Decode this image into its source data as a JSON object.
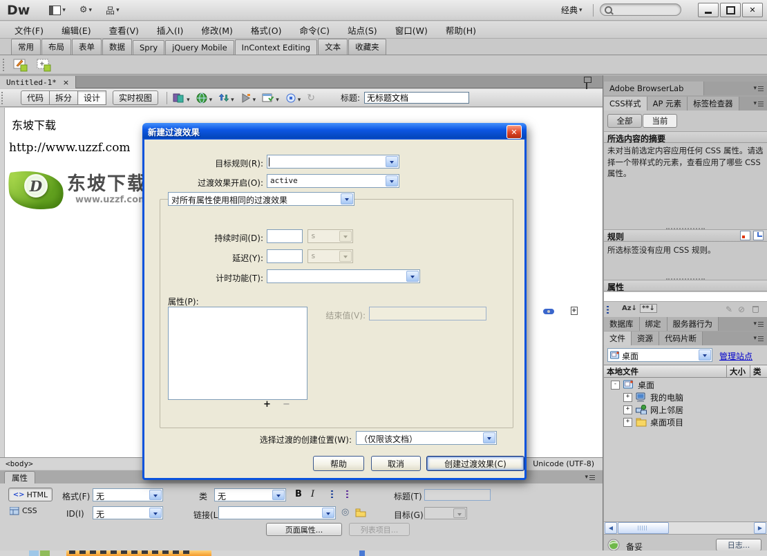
{
  "colors": {
    "accent_blue": "#0054E3",
    "dialog_bg": "#ECE9D8",
    "link_blue": "#0000CC",
    "xp_button_border": "#003C74",
    "close_red": "#D8442A",
    "chrome_gray": "#C9C9C9"
  },
  "icons": {
    "caret_down": "▾",
    "window_close": "✕",
    "dialog_close": "✕",
    "tab_close": "×",
    "scroll_left": "◀",
    "scroll_right": "▶",
    "refresh": "↻",
    "target": "◎",
    "gear": "⚙",
    "site_glyph": "品",
    "expand_plus": "+",
    "collapse_minus": "-"
  },
  "titlebar": {
    "logo": "Dw",
    "workspace": "经典"
  },
  "menubar": {
    "items": [
      "文件(F)",
      "编辑(E)",
      "查看(V)",
      "插入(I)",
      "修改(M)",
      "格式(O)",
      "命令(C)",
      "站点(S)",
      "窗口(W)",
      "帮助(H)"
    ]
  },
  "insert_bar": {
    "tabs": [
      "常用",
      "布局",
      "表单",
      "数据",
      "Spry",
      "jQuery Mobile",
      "InContext Editing",
      "文本",
      "收藏夹"
    ],
    "active_tab": "InContext Editing"
  },
  "doc": {
    "tab_title": "Untitled-1*",
    "views": [
      "代码",
      "拆分",
      "设计",
      "实时视图"
    ],
    "active_view": "设计",
    "title_label": "标题:",
    "title_value": "无标题文档",
    "heading": "东坡下载",
    "url": "http://www.uzzf.com",
    "logo_initial": "D",
    "logo_title": "东坡下载",
    "logo_sub": "www.uzzf.com",
    "tag": "<body>",
    "encoding": "Unicode (UTF-8)"
  },
  "dialog": {
    "title": "新建过渡效果",
    "target_rule_label": "目标规则(R):",
    "transition_on_label": "过渡效果开启(O):",
    "transition_on_value": "active",
    "all_properties_option": "对所有属性使用相同的过渡效果",
    "duration_label": "持续时间(D):",
    "delay_label": "延迟(Y):",
    "unit": "s",
    "timing_label": "计时功能(T):",
    "property_label": "属性(P):",
    "end_value_label": "结束值(V):",
    "add": "+",
    "remove": "−",
    "where_label": "选择过渡的创建位置(W):",
    "where_value": "（仅限该文档）",
    "help_button": "帮助",
    "cancel_button": "取消",
    "create_button": "创建过渡效果(C)"
  },
  "css_panel": {
    "browserlab": "Adobe BrowserLab",
    "tabs": [
      "CSS样式",
      "AP 元素",
      "标签检查器"
    ],
    "all_button": "全部",
    "current_button": "当前",
    "summary_title": "所选内容的摘要",
    "summary_text": "未对当前选定内容应用任何 CSS 属性。请选择一个带样式的元素，查看应用了哪些 CSS 属性。",
    "rules_title": "规则",
    "rules_text": "所选标签没有应用 CSS 规则。",
    "properties_title": "属性",
    "az_sort": "Az↓",
    "custom_sort": "**↓"
  },
  "server_tabs": {
    "tabs": [
      "数据库",
      "绑定",
      "服务器行为"
    ]
  },
  "files_panel": {
    "tabs": [
      "文件",
      "资源",
      "代码片断"
    ],
    "active_tab": "文件",
    "site": "桌面",
    "manage_sites": "管理站点",
    "headers": [
      "本地文件",
      "大小",
      "类"
    ],
    "tree": [
      {
        "label": "桌面"
      },
      {
        "label": "我的电脑"
      },
      {
        "label": "网上邻居"
      },
      {
        "label": "桌面项目"
      }
    ],
    "status": "备妥",
    "log_button": "日志..."
  },
  "inspector": {
    "tab": "属性",
    "html_button": "HTML",
    "css_button": "CSS",
    "format_label": "格式(F)",
    "format_value": "无",
    "class_label": "类",
    "class_value": "无",
    "id_label": "ID(I)",
    "id_value": "无",
    "link_label": "链接(L)",
    "bold": "B",
    "italic": "I",
    "title_label": "标题(T)",
    "target_label": "目标(G)",
    "page_properties_button": "页面属性...",
    "list_item_button": "列表项目..."
  }
}
